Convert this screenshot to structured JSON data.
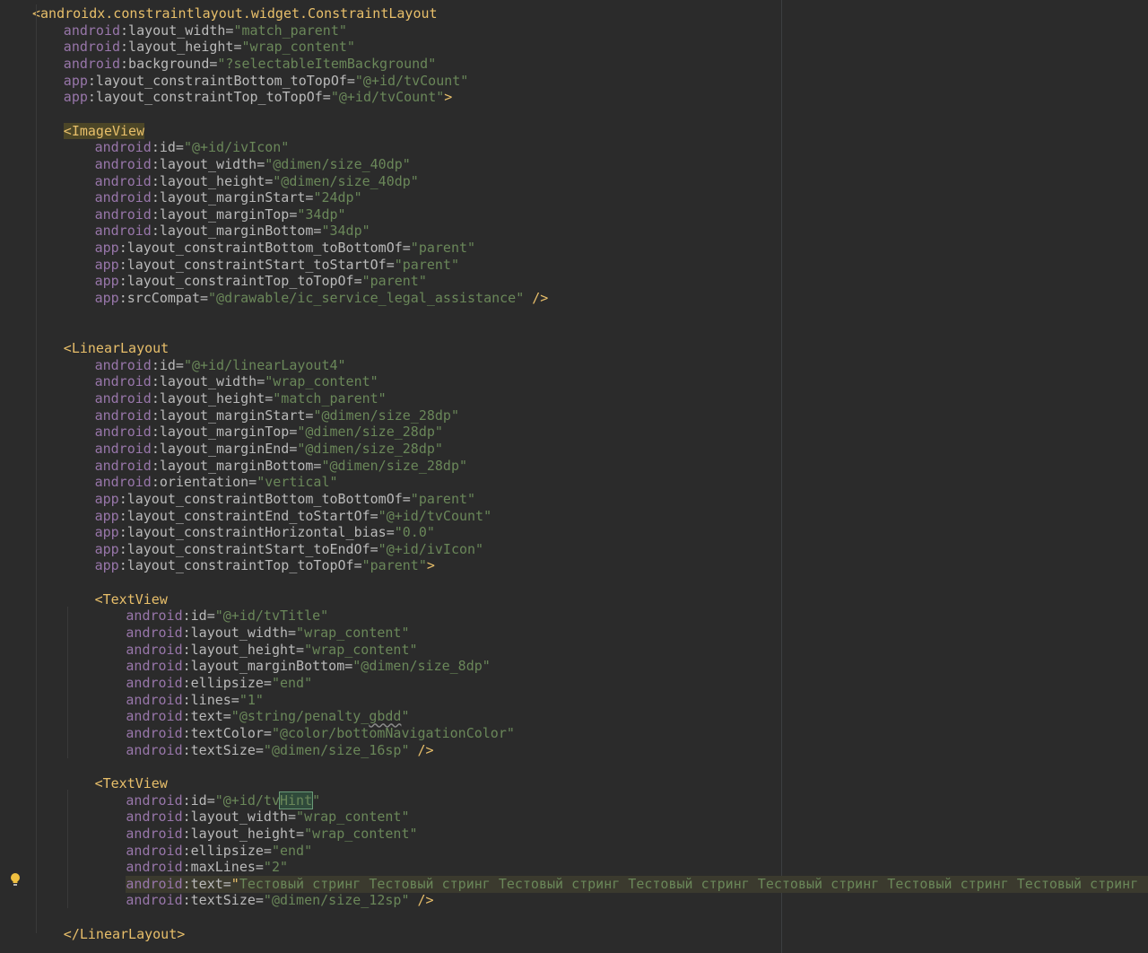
{
  "editor": {
    "lines": [
      {
        "indent": 0,
        "parts": [
          {
            "c": "tag",
            "t": "<androidx.constraintlayout.widget.ConstraintLayout"
          }
        ]
      },
      {
        "indent": 1,
        "parts": [
          {
            "c": "ns",
            "t": "android"
          },
          {
            "c": "attr",
            "t": ":layout_width="
          },
          {
            "c": "val",
            "t": "\"match_parent\""
          }
        ]
      },
      {
        "indent": 1,
        "parts": [
          {
            "c": "ns",
            "t": "android"
          },
          {
            "c": "attr",
            "t": ":layout_height="
          },
          {
            "c": "val",
            "t": "\"wrap_content\""
          }
        ]
      },
      {
        "indent": 1,
        "parts": [
          {
            "c": "ns",
            "t": "android"
          },
          {
            "c": "attr",
            "t": ":background="
          },
          {
            "c": "val",
            "t": "\"?selectableItemBackground\""
          }
        ]
      },
      {
        "indent": 1,
        "parts": [
          {
            "c": "ns",
            "t": "app"
          },
          {
            "c": "attr",
            "t": ":layout_constraintBottom_toTopOf="
          },
          {
            "c": "val",
            "t": "\"@+id/tvCount\""
          }
        ]
      },
      {
        "indent": 1,
        "parts": [
          {
            "c": "ns",
            "t": "app"
          },
          {
            "c": "attr",
            "t": ":layout_constraintTop_toTopOf="
          },
          {
            "c": "val",
            "t": "\"@+id/tvCount\""
          },
          {
            "c": "tag",
            "t": ">"
          }
        ]
      },
      {
        "indent": 0,
        "parts": []
      },
      {
        "indent": 1,
        "parts": [
          {
            "c": "tag-hl",
            "t": "<ImageView"
          }
        ]
      },
      {
        "indent": 2,
        "parts": [
          {
            "c": "ns",
            "t": "android"
          },
          {
            "c": "attr",
            "t": ":id="
          },
          {
            "c": "val",
            "t": "\"@+id/ivIcon\""
          }
        ]
      },
      {
        "indent": 2,
        "parts": [
          {
            "c": "ns",
            "t": "android"
          },
          {
            "c": "attr",
            "t": ":layout_width="
          },
          {
            "c": "val",
            "t": "\"@dimen/size_40dp\""
          }
        ]
      },
      {
        "indent": 2,
        "parts": [
          {
            "c": "ns",
            "t": "android"
          },
          {
            "c": "attr",
            "t": ":layout_height="
          },
          {
            "c": "val",
            "t": "\"@dimen/size_40dp\""
          }
        ]
      },
      {
        "indent": 2,
        "parts": [
          {
            "c": "ns",
            "t": "android"
          },
          {
            "c": "attr",
            "t": ":layout_marginStart="
          },
          {
            "c": "val",
            "t": "\"24dp\""
          }
        ]
      },
      {
        "indent": 2,
        "parts": [
          {
            "c": "ns",
            "t": "android"
          },
          {
            "c": "attr",
            "t": ":layout_marginTop="
          },
          {
            "c": "val",
            "t": "\"34dp\""
          }
        ]
      },
      {
        "indent": 2,
        "parts": [
          {
            "c": "ns",
            "t": "android"
          },
          {
            "c": "attr",
            "t": ":layout_marginBottom="
          },
          {
            "c": "val",
            "t": "\"34dp\""
          }
        ]
      },
      {
        "indent": 2,
        "parts": [
          {
            "c": "ns",
            "t": "app"
          },
          {
            "c": "attr",
            "t": ":layout_constraintBottom_toBottomOf="
          },
          {
            "c": "val",
            "t": "\"parent\""
          }
        ]
      },
      {
        "indent": 2,
        "parts": [
          {
            "c": "ns",
            "t": "app"
          },
          {
            "c": "attr",
            "t": ":layout_constraintStart_toStartOf="
          },
          {
            "c": "val",
            "t": "\"parent\""
          }
        ]
      },
      {
        "indent": 2,
        "parts": [
          {
            "c": "ns",
            "t": "app"
          },
          {
            "c": "attr",
            "t": ":layout_constraintTop_toTopOf="
          },
          {
            "c": "val",
            "t": "\"parent\""
          }
        ]
      },
      {
        "indent": 2,
        "parts": [
          {
            "c": "ns",
            "t": "app"
          },
          {
            "c": "attr",
            "t": ":srcCompat="
          },
          {
            "c": "val",
            "t": "\"@drawable/ic_service_legal_assistance\""
          },
          {
            "c": "tag",
            "t": " />"
          }
        ]
      },
      {
        "indent": 0,
        "parts": []
      },
      {
        "indent": 0,
        "parts": []
      },
      {
        "indent": 1,
        "parts": [
          {
            "c": "tag",
            "t": "<LinearLayout"
          }
        ]
      },
      {
        "indent": 2,
        "parts": [
          {
            "c": "ns",
            "t": "android"
          },
          {
            "c": "attr",
            "t": ":id="
          },
          {
            "c": "val",
            "t": "\"@+id/linearLayout4\""
          }
        ]
      },
      {
        "indent": 2,
        "parts": [
          {
            "c": "ns",
            "t": "android"
          },
          {
            "c": "attr",
            "t": ":layout_width="
          },
          {
            "c": "val",
            "t": "\"wrap_content\""
          }
        ]
      },
      {
        "indent": 2,
        "parts": [
          {
            "c": "ns",
            "t": "android"
          },
          {
            "c": "attr",
            "t": ":layout_height="
          },
          {
            "c": "val",
            "t": "\"match_parent\""
          }
        ]
      },
      {
        "indent": 2,
        "parts": [
          {
            "c": "ns",
            "t": "android"
          },
          {
            "c": "attr",
            "t": ":layout_marginStart="
          },
          {
            "c": "val",
            "t": "\"@dimen/size_28dp\""
          }
        ]
      },
      {
        "indent": 2,
        "parts": [
          {
            "c": "ns",
            "t": "android"
          },
          {
            "c": "attr",
            "t": ":layout_marginTop="
          },
          {
            "c": "val",
            "t": "\"@dimen/size_28dp\""
          }
        ]
      },
      {
        "indent": 2,
        "parts": [
          {
            "c": "ns",
            "t": "android"
          },
          {
            "c": "attr",
            "t": ":layout_marginEnd="
          },
          {
            "c": "val",
            "t": "\"@dimen/size_28dp\""
          }
        ]
      },
      {
        "indent": 2,
        "parts": [
          {
            "c": "ns",
            "t": "android"
          },
          {
            "c": "attr",
            "t": ":layout_marginBottom="
          },
          {
            "c": "val",
            "t": "\"@dimen/size_28dp\""
          }
        ]
      },
      {
        "indent": 2,
        "parts": [
          {
            "c": "ns",
            "t": "android"
          },
          {
            "c": "attr",
            "t": ":orientation="
          },
          {
            "c": "val",
            "t": "\"vertical\""
          }
        ]
      },
      {
        "indent": 2,
        "parts": [
          {
            "c": "ns",
            "t": "app"
          },
          {
            "c": "attr",
            "t": ":layout_constraintBottom_toBottomOf="
          },
          {
            "c": "val",
            "t": "\"parent\""
          }
        ]
      },
      {
        "indent": 2,
        "parts": [
          {
            "c": "ns",
            "t": "app"
          },
          {
            "c": "attr",
            "t": ":layout_constraintEnd_toStartOf="
          },
          {
            "c": "val",
            "t": "\"@+id/tvCount\""
          }
        ]
      },
      {
        "indent": 2,
        "parts": [
          {
            "c": "ns",
            "t": "app"
          },
          {
            "c": "attr",
            "t": ":layout_constraintHorizontal_bias="
          },
          {
            "c": "val",
            "t": "\"0.0\""
          }
        ]
      },
      {
        "indent": 2,
        "parts": [
          {
            "c": "ns",
            "t": "app"
          },
          {
            "c": "attr",
            "t": ":layout_constraintStart_toEndOf="
          },
          {
            "c": "val",
            "t": "\"@+id/ivIcon\""
          }
        ]
      },
      {
        "indent": 2,
        "parts": [
          {
            "c": "ns",
            "t": "app"
          },
          {
            "c": "attr",
            "t": ":layout_constraintTop_toTopOf="
          },
          {
            "c": "val",
            "t": "\"parent\""
          },
          {
            "c": "tag",
            "t": ">"
          }
        ]
      },
      {
        "indent": 0,
        "parts": []
      },
      {
        "indent": 2,
        "parts": [
          {
            "c": "tag",
            "t": "<TextView"
          }
        ]
      },
      {
        "indent": 3,
        "parts": [
          {
            "c": "ns",
            "t": "android"
          },
          {
            "c": "attr",
            "t": ":id="
          },
          {
            "c": "val",
            "t": "\"@+id/tvTitle\""
          }
        ]
      },
      {
        "indent": 3,
        "parts": [
          {
            "c": "ns",
            "t": "android"
          },
          {
            "c": "attr",
            "t": ":layout_width="
          },
          {
            "c": "val",
            "t": "\"wrap_content\""
          }
        ]
      },
      {
        "indent": 3,
        "parts": [
          {
            "c": "ns",
            "t": "android"
          },
          {
            "c": "attr",
            "t": ":layout_height="
          },
          {
            "c": "val",
            "t": "\"wrap_content\""
          }
        ]
      },
      {
        "indent": 3,
        "parts": [
          {
            "c": "ns",
            "t": "android"
          },
          {
            "c": "attr",
            "t": ":layout_marginBottom="
          },
          {
            "c": "val",
            "t": "\"@dimen/size_8dp\""
          }
        ]
      },
      {
        "indent": 3,
        "parts": [
          {
            "c": "ns",
            "t": "android"
          },
          {
            "c": "attr",
            "t": ":ellipsize="
          },
          {
            "c": "val",
            "t": "\"end\""
          }
        ]
      },
      {
        "indent": 3,
        "parts": [
          {
            "c": "ns",
            "t": "android"
          },
          {
            "c": "attr",
            "t": ":lines="
          },
          {
            "c": "val",
            "t": "\"1\""
          }
        ]
      },
      {
        "indent": 3,
        "parts": [
          {
            "c": "ns",
            "t": "android"
          },
          {
            "c": "attr",
            "t": ":text="
          },
          {
            "c": "val",
            "t": "\"@string/penalty_"
          },
          {
            "c": "val squiggle",
            "t": "gbdd"
          },
          {
            "c": "val",
            "t": "\""
          }
        ]
      },
      {
        "indent": 3,
        "parts": [
          {
            "c": "ns",
            "t": "android"
          },
          {
            "c": "attr",
            "t": ":textColor="
          },
          {
            "c": "val",
            "t": "\"@color/bottomNavigationColor\""
          }
        ]
      },
      {
        "indent": 3,
        "parts": [
          {
            "c": "ns",
            "t": "android"
          },
          {
            "c": "attr",
            "t": ":textSize="
          },
          {
            "c": "val",
            "t": "\"@dimen/size_16sp\""
          },
          {
            "c": "tag",
            "t": " />"
          }
        ]
      },
      {
        "indent": 0,
        "parts": []
      },
      {
        "indent": 2,
        "parts": [
          {
            "c": "tag",
            "t": "<TextView"
          }
        ]
      },
      {
        "indent": 3,
        "parts": [
          {
            "c": "ns",
            "t": "android"
          },
          {
            "c": "attr",
            "t": ":id="
          },
          {
            "c": "val",
            "t": "\"@+id/tv"
          },
          {
            "c": "word-hl",
            "t": "Hint"
          },
          {
            "c": "val",
            "t": "\""
          }
        ]
      },
      {
        "indent": 3,
        "parts": [
          {
            "c": "ns",
            "t": "android"
          },
          {
            "c": "attr",
            "t": ":layout_width="
          },
          {
            "c": "val",
            "t": "\"wrap_content\""
          }
        ]
      },
      {
        "indent": 3,
        "parts": [
          {
            "c": "ns",
            "t": "android"
          },
          {
            "c": "attr",
            "t": ":layout_height="
          },
          {
            "c": "val",
            "t": "\"wrap_content\""
          }
        ]
      },
      {
        "indent": 3,
        "parts": [
          {
            "c": "ns",
            "t": "android"
          },
          {
            "c": "attr",
            "t": ":ellipsize="
          },
          {
            "c": "val",
            "t": "\"end\""
          }
        ]
      },
      {
        "indent": 3,
        "parts": [
          {
            "c": "ns",
            "t": "android"
          },
          {
            "c": "attr",
            "t": ":maxLines="
          },
          {
            "c": "val",
            "t": "\"2\""
          }
        ]
      },
      {
        "indent": 3,
        "highlight": true,
        "parts": [
          {
            "c": "ns",
            "t": "android"
          },
          {
            "c": "attr",
            "t": ":text="
          },
          {
            "c": "tag",
            "t": "\""
          },
          {
            "c": "val",
            "t": "Тестовый стринг Тестовый стринг Тестовый стринг Тестовый стринг Тестовый стринг Тестовый стринг Тестовый стринг "
          },
          {
            "c": "tag",
            "t": "\""
          }
        ]
      },
      {
        "indent": 3,
        "parts": [
          {
            "c": "ns",
            "t": "android"
          },
          {
            "c": "attr",
            "t": ":textSize="
          },
          {
            "c": "val",
            "t": "\"@dimen/size_12sp\""
          },
          {
            "c": "tag",
            "t": " />"
          }
        ]
      },
      {
        "indent": 0,
        "parts": []
      },
      {
        "indent": 1,
        "parts": [
          {
            "c": "tag",
            "t": "</LinearLayout>"
          }
        ]
      }
    ]
  },
  "colors": {
    "background": "#2b2b2b",
    "tag": "#e8bf6a",
    "namespace": "#9876aa",
    "attribute": "#bababa",
    "value": "#6a8759"
  },
  "gutter": {
    "intention_icon": "lightbulb-icon"
  }
}
